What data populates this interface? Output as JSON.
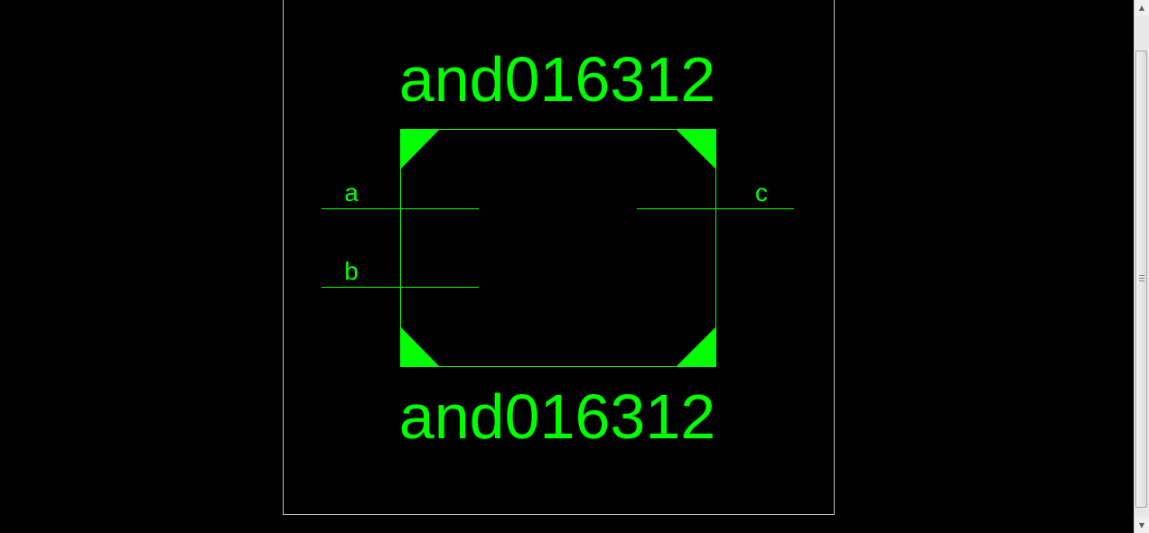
{
  "symbol": {
    "name_top": "and016312",
    "name_bottom": "and016312",
    "pins": {
      "a": "a",
      "b": "b",
      "c": "c"
    }
  },
  "colors": {
    "background": "#000000",
    "symbol": "#00ff00",
    "frame": "#c0c0c0"
  },
  "scrollbar": {
    "up_icon": "triangle-up",
    "down_icon": "triangle-down"
  }
}
